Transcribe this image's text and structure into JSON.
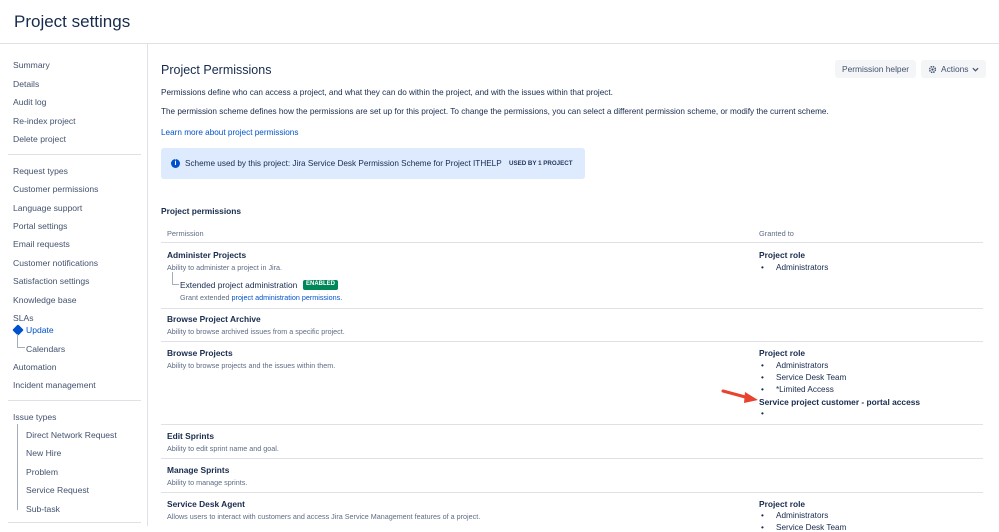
{
  "header": {
    "title": "Project settings"
  },
  "sidebar": {
    "group1": [
      "Summary",
      "Details",
      "Audit log",
      "Re-index project",
      "Delete project"
    ],
    "group2": [
      "Request types",
      "Customer permissions",
      "Language support",
      "Portal settings",
      "Email requests",
      "Customer notifications",
      "Satisfaction settings",
      "Knowledge base",
      "SLAs"
    ],
    "sla_update": "Update",
    "sla_calendars": "Calendars",
    "group3": [
      "Automation",
      "Incident management"
    ],
    "issue_types_label": "Issue types",
    "issue_types": [
      "Direct Network Request",
      "New Hire",
      "Problem",
      "Service Request",
      "Sub-task"
    ]
  },
  "main": {
    "title": "Project Permissions",
    "permission_helper": "Permission helper",
    "actions": "Actions",
    "desc1": "Permissions define who can access a project, and what they can do within the project, and with the issues within that project.",
    "desc2": "The permission scheme defines how the permissions are set up for this project. To change the permissions, you can select a different permission scheme, or modify the current scheme.",
    "learn_more": "Learn more about project permissions",
    "scheme_text": "Scheme used by this project: Jira Service Desk Permission Scheme for Project ITHELP",
    "scheme_badge": "USED BY 1 PROJECT",
    "section_title": "Project permissions",
    "col_permission": "Permission",
    "col_granted": "Granted to"
  },
  "permissions": {
    "administer": {
      "name": "Administer Projects",
      "desc": "Ability to administer a project in Jira.",
      "grant_head": "Project role",
      "grants": [
        "Administrators"
      ]
    },
    "extended": {
      "name": "Extended project administration",
      "badge": "ENABLED",
      "desc_prefix": "Grant extended ",
      "desc_link": "project administration permissions."
    },
    "archive": {
      "name": "Browse Project Archive",
      "desc": "Ability to browse archived issues from a specific project."
    },
    "browse": {
      "name": "Browse Projects",
      "desc": "Ability to browse projects and the issues within them.",
      "grant_head": "Project role",
      "grants": [
        "Administrators",
        "Service Desk Team",
        "*Limited Access"
      ],
      "grant_head2": "Service project customer - portal access"
    },
    "edit_sprints": {
      "name": "Edit Sprints",
      "desc": "Ability to edit sprint name and goal."
    },
    "manage_sprints": {
      "name": "Manage Sprints",
      "desc": "Ability to manage sprints."
    },
    "agent": {
      "name": "Service Desk Agent",
      "desc": "Allows users to interact with customers and access Jira Service Management features of a project.",
      "grant_head": "Project role",
      "grants": [
        "Administrators",
        "Service Desk Team"
      ]
    }
  },
  "colors": {
    "accent": "#0052cc",
    "annotation_arrow": "#e8432f",
    "enabled": "#00875a"
  }
}
